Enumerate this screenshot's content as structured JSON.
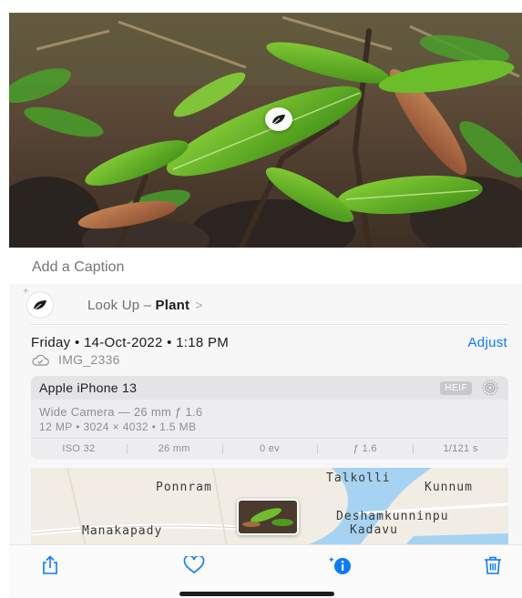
{
  "caption": {
    "placeholder": "Add a Caption"
  },
  "lookup": {
    "prefix": "Look Up – ",
    "subject": "Plant",
    "chevron": ">"
  },
  "datetime": {
    "text": "Friday • 14-Oct-2022 • 1:18 PM",
    "adjust_label": "Adjust"
  },
  "file": {
    "name": "IMG_2336"
  },
  "camera": {
    "model": "Apple iPhone 13",
    "format_badge": "HEIF",
    "lens": "Wide Camera — 26 mm ƒ 1.6",
    "specs": "12 MP • 3024 × 4032 • 1.5 MB",
    "exif": [
      "ISO 32",
      "26 mm",
      "0 ev",
      "ƒ 1.6",
      "1/121 s"
    ]
  },
  "map": {
    "labels": {
      "talkolli": "Talkolli",
      "ponnram": "Ponnram",
      "kunnum": "Kunnum",
      "deshamkunninpu": "Deshamkunninpu",
      "kadavu": "Kadavu",
      "manakapady": "Manakapady"
    }
  },
  "toolbar": {
    "icons": [
      "share-icon",
      "heart-icon",
      "info-sparkle-icon",
      "trash-icon"
    ]
  },
  "colors": {
    "accent": "#0a7aff",
    "river": "#a6d3f2",
    "map_bg": "#f1ede4"
  }
}
